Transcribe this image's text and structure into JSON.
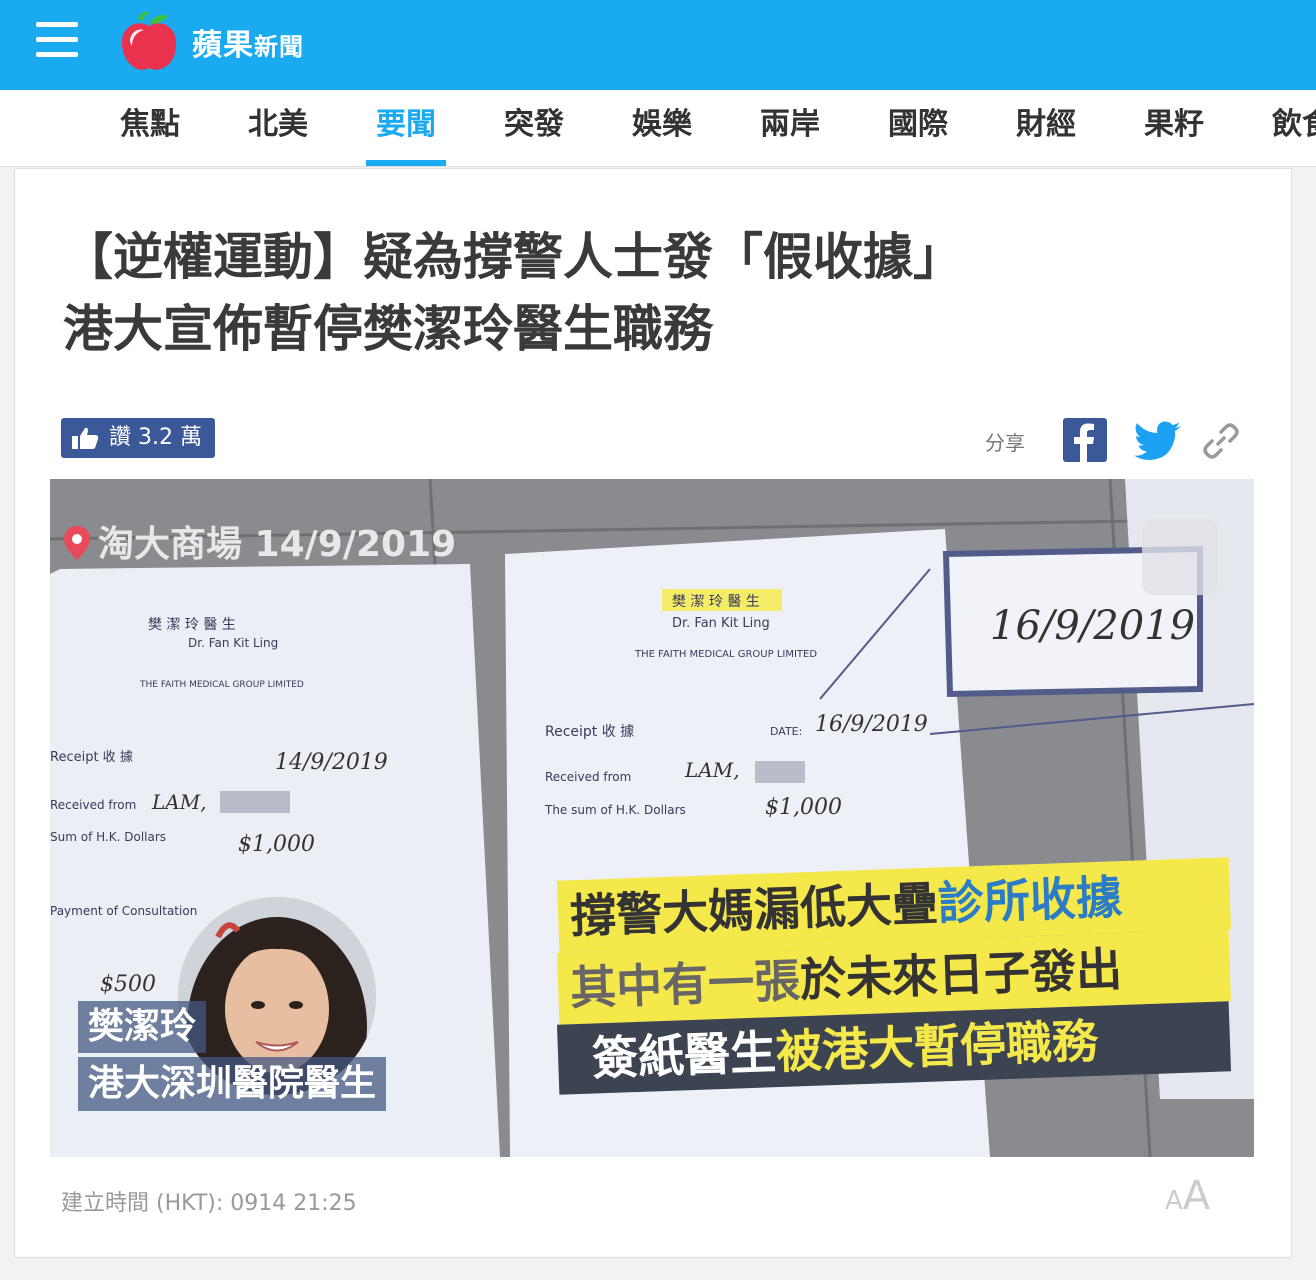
{
  "header": {
    "logo_name": "蘋果",
    "logo_sub": "新聞",
    "brand_color": "#1aaaf0"
  },
  "nav": {
    "items": [
      "焦點",
      "北美",
      "要聞",
      "突發",
      "娛樂",
      "兩岸",
      "國際",
      "財經",
      "果籽",
      "飲食"
    ],
    "active_index": 2
  },
  "article": {
    "title_line1": "【逆權運動】疑為撐警人士發「假收據」",
    "title_line2": "港大宣佈暫停樊潔玲醫生職務",
    "like_label": "讚 3.2 萬",
    "share_label": "分享",
    "timestamp": "建立時間 (HKT): 0914 21:25",
    "font_small": "A",
    "font_large": "A"
  },
  "image": {
    "location": "淘大商場 14/9/2019",
    "person_name": "樊潔玲",
    "person_title": "港大深圳醫院醫生",
    "caption1_a": "撐警大媽漏低大疊",
    "caption1_b": "診所收據",
    "caption2_a": "其中有一張",
    "caption2_b": "於未來日子發出",
    "caption3_a": "簽紙醫生",
    "caption3_b": "被港大暫停職務",
    "doc_left": {
      "doctor": "樊 潔 玲 醫 生",
      "doctor_en": "Dr. Fan Kit Ling",
      "group": "THE FAITH MEDICAL GROUP LIMITED",
      "receipt": "Receipt 收 據",
      "date": "14/9/2019",
      "name": "LAM,",
      "amount": "$1,000",
      "surgery": "$500",
      "received_from": "Received from",
      "sum": "Sum of H.K. Dollars",
      "consultation": "Payment of Consultation"
    },
    "doc_right": {
      "doctor": "樊 潔 玲 醫 生",
      "doctor_en": "Dr. Fan Kit Ling",
      "group": "THE FAITH MEDICAL GROUP LIMITED",
      "receipt": "Receipt 收 據",
      "date": "16/9/2019",
      "name": "LAM,",
      "amount": "$1,000",
      "received_from": "Received from",
      "sum": "The sum of H.K. Dollars",
      "date_label": "DATE:"
    },
    "zoom_date": "16/9/2019"
  }
}
